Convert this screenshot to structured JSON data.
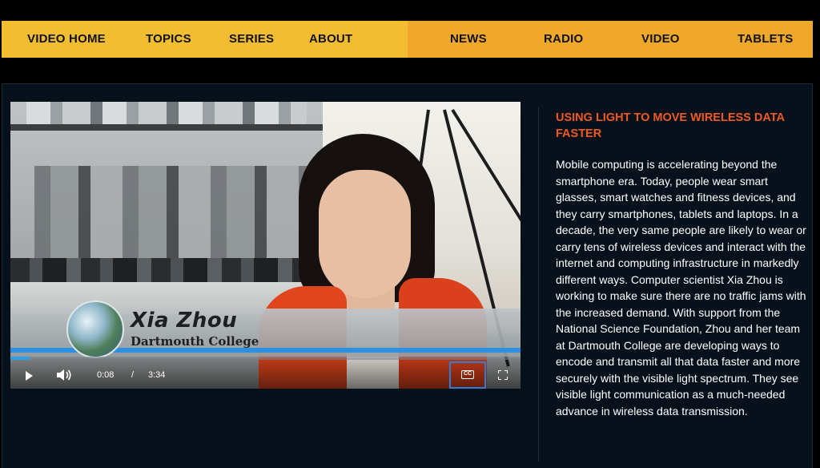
{
  "nav": {
    "left": [
      "VIDEO HOME",
      "TOPICS",
      "SERIES",
      "ABOUT"
    ],
    "right": [
      "NEWS",
      "RADIO",
      "VIDEO",
      "TABLETS"
    ]
  },
  "video": {
    "lower_third": {
      "name": "Xia Zhou",
      "organization": "Dartmouth College"
    },
    "controls": {
      "current_time": "0:08",
      "separator": "/",
      "duration": "3:34",
      "progress": 0.0374,
      "cc_label": "CC"
    }
  },
  "article": {
    "title": "USING LIGHT TO MOVE WIRELESS DATA FASTER",
    "body": "Mobile computing is accelerating beyond the smartphone era. Today, people wear smart glasses, smart watches and fitness devices, and they carry smartphones, tablets and laptops. In a decade, the very same people are likely to wear or carry tens of wireless devices and interact with the internet and computing infrastructure in markedly different ways. Computer scientist Xia Zhou is working to make sure there are no traffic jams with the increased demand. With support from the National Science Foundation, Zhou and her team at Dartmouth College are developing ways to encode and transmit all that data faster and more securely with the visible light spectrum. They see visible light communication as a much-needed advance in wireless data transmission."
  },
  "colors": {
    "nav_left": "#f3bd32",
    "nav_right": "#f0a82a",
    "accent_title": "#ef5a24",
    "panel": "#07111b",
    "progress": "#2aa1e8"
  }
}
